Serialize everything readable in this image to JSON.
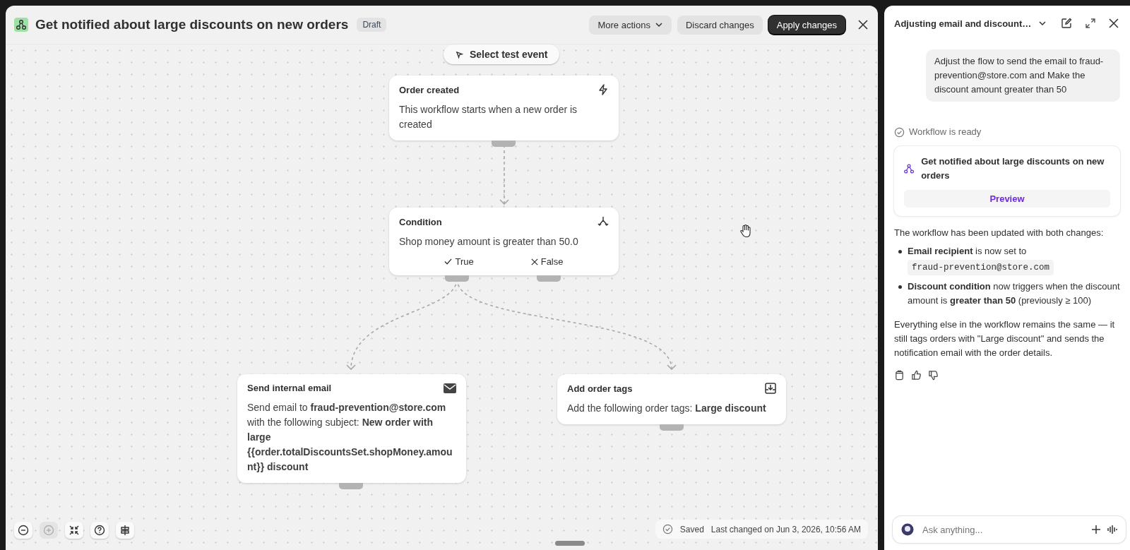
{
  "header": {
    "title": "Get notified about large discounts on new orders",
    "badge": "Draft",
    "buttons": [
      {
        "label": "More actions",
        "kind": "menu"
      },
      {
        "label": "Discard changes",
        "kind": "secondary"
      },
      {
        "label": "Apply changes",
        "kind": "primary"
      }
    ]
  },
  "canvas": {
    "test_event": "Select test event",
    "nodes": [
      {
        "kind": "trigger",
        "title": "Order created",
        "body": "This workflow starts when a new order is created"
      },
      {
        "kind": "condition",
        "title": "Condition",
        "body": "Shop money amount is greater than 50.0",
        "branches": [
          {
            "kind": "true",
            "label": "True"
          },
          {
            "kind": "false",
            "label": "False"
          }
        ]
      },
      {
        "kind": "email",
        "title": "Send internal email",
        "body": "Send email to **fraud-prevention@store.com** with the following subject: **New order with large {{order.totalDiscountsSet.shopMoney.amount}} discount**"
      },
      {
        "kind": "tags",
        "title": "Add order tags",
        "body": "Add the following order tags: **Large discount**"
      }
    ],
    "zoom_controls": [
      {
        "kind": "zoom-out",
        "disabled": false
      },
      {
        "kind": "zoom-in",
        "disabled": true
      },
      {
        "kind": "fit",
        "disabled": false
      },
      {
        "kind": "help",
        "disabled": false
      },
      {
        "kind": "settings",
        "disabled": false
      }
    ],
    "status": {
      "saved": "Saved",
      "last_changed": "Last changed on Jun 3, 2026, 10:56 AM"
    }
  },
  "chat": {
    "title": "Adjusting email and discount…",
    "user_message": "Adjust the flow to send the email to fraud-prevention@store.com and Make the discount amount greater than 50",
    "ready": "Workflow is ready",
    "workflow_card": {
      "title": "Get notified about large discounts on new orders",
      "button": "Preview"
    },
    "intro": "The workflow has been updated with both changes:",
    "bullets": [
      {
        "text": "**Email recipient** is now set to",
        "code": "fraud-prevention@store.com"
      },
      {
        "text": "**Discount condition** now triggers when the discount amount is **greater than 50** (previously ≥ 100)"
      }
    ],
    "outro": "Everything else in the workflow remains the same — it still tags orders with \"Large discount\" and sends the notification email with the order details.",
    "input": {
      "placeholder": "Ask anything..."
    }
  }
}
